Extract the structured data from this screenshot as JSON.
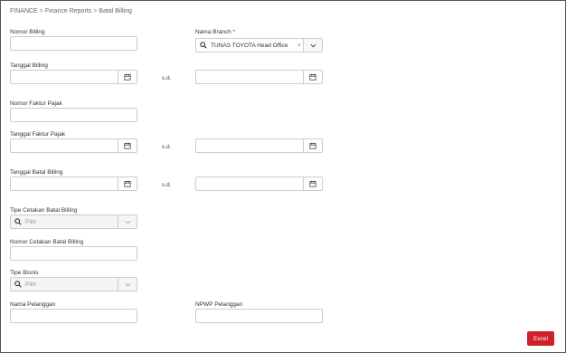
{
  "breadcrumb": [
    "FINANCE",
    "Finance Reports",
    "Batal Billing"
  ],
  "fields": {
    "nomor_billing": {
      "label": "Nomor Billing",
      "value": ""
    },
    "nama_branch": {
      "label": "Nama Branch *",
      "value": "TUNAS TOYOTA Head Office",
      "clear": "×"
    },
    "tanggal_billing": {
      "label": "Tanggal Billing",
      "from": "",
      "to": "",
      "sd": "s.d."
    },
    "nomor_faktur_pajak": {
      "label": "Nomor Faktur Pajak",
      "value": ""
    },
    "tanggal_faktur_pajak": {
      "label": "Tanggal Faktur Pajak",
      "from": "",
      "to": "",
      "sd": "s.d."
    },
    "tanggal_batal_billing": {
      "label": "Tanggal Batal Billing",
      "from": "",
      "to": "",
      "sd": "s.d."
    },
    "tipe_cetakan_batal_billing": {
      "label": "Tipe Cetakan Batal Billing",
      "placeholder": "Pilih"
    },
    "nomor_cetakan_batal_billing": {
      "label": "Nomor Cetakan Batal Billing",
      "value": ""
    },
    "tipe_bisnis": {
      "label": "Tipe Bisnis",
      "placeholder": "Pilih"
    },
    "nama_pelanggan": {
      "label": "Nama Pelanggan",
      "value": ""
    },
    "npwp_pelanggan": {
      "label": "NPWP Pelanggan",
      "value": ""
    }
  },
  "actions": {
    "excel_label": "Excel"
  },
  "colors": {
    "accent": "#d0212a",
    "border": "#cccccc"
  },
  "icons": {
    "calendar": "calendar-icon",
    "search": "search-icon",
    "chevron": "chevron-down-icon"
  }
}
